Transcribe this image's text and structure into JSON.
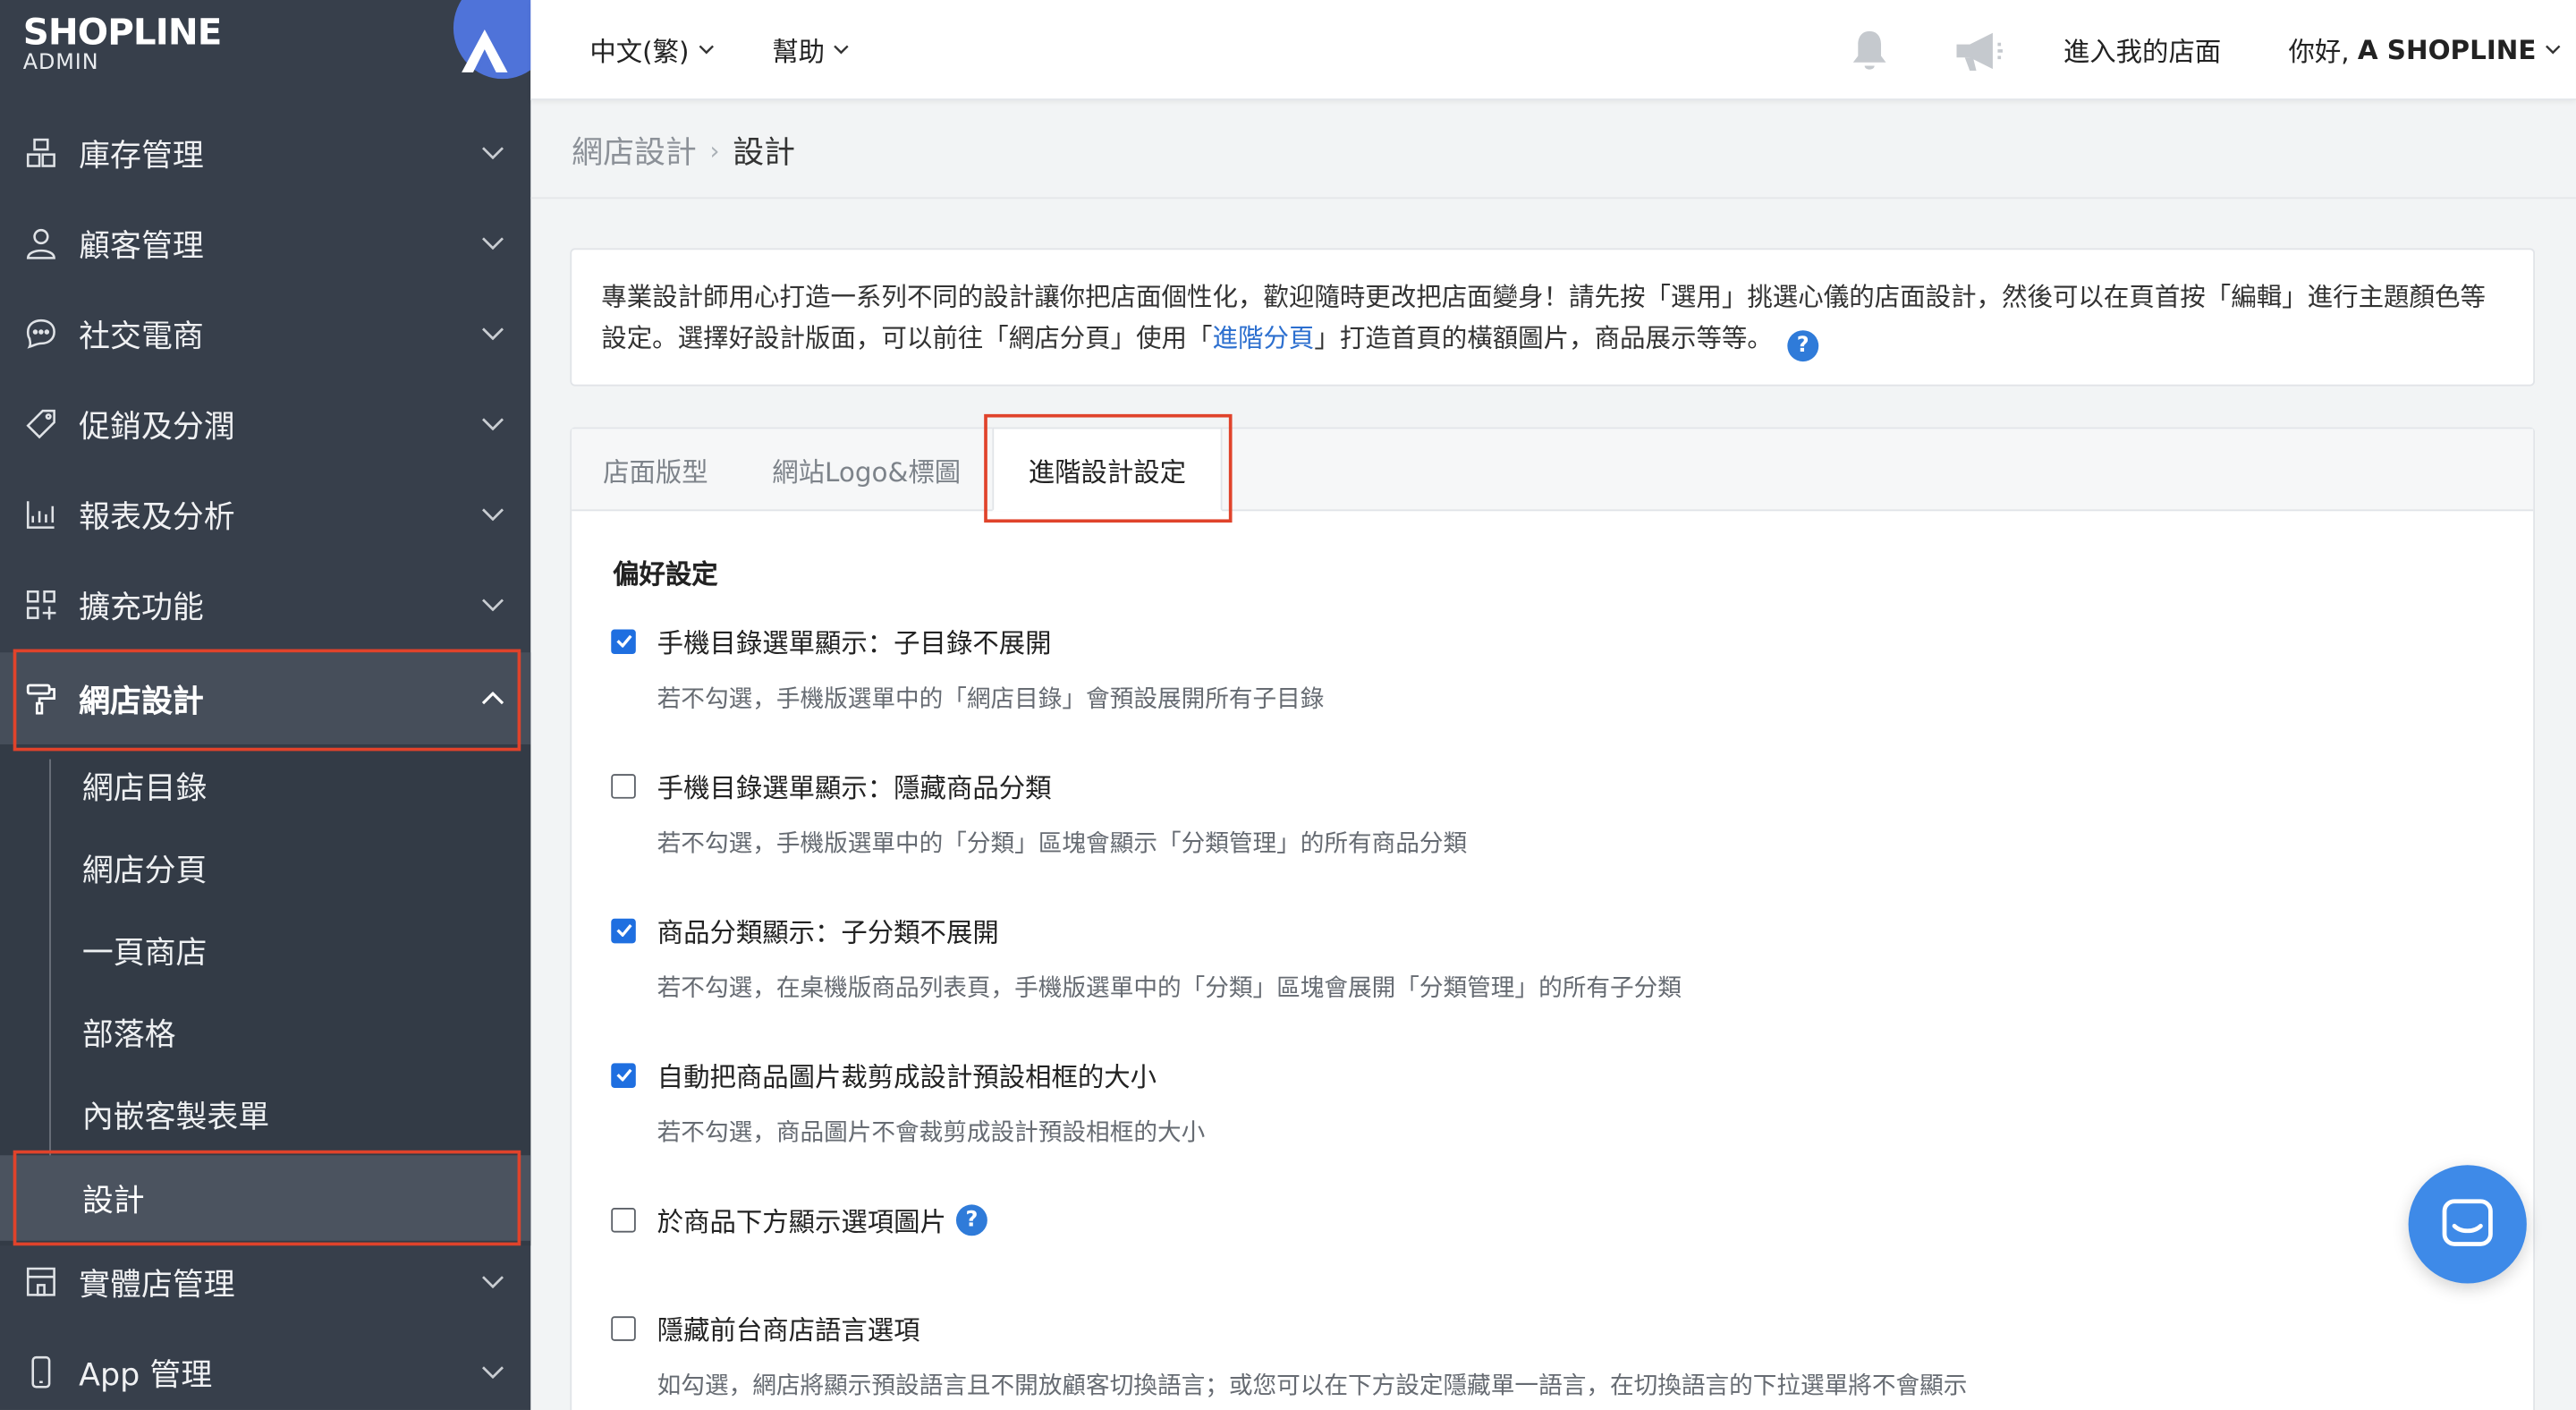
{
  "brand": {
    "logo_text": "SHOPLINE",
    "logo_sub": "ADMIN"
  },
  "sidebar": {
    "items": [
      {
        "label": "庫存管理",
        "icon": "inventory-icon"
      },
      {
        "label": "顧客管理",
        "icon": "user-icon"
      },
      {
        "label": "社交電商",
        "icon": "chat-bubble-icon"
      },
      {
        "label": "促銷及分潤",
        "icon": "tag-icon"
      },
      {
        "label": "報表及分析",
        "icon": "chart-icon"
      },
      {
        "label": "擴充功能",
        "icon": "apps-plus-icon"
      },
      {
        "label": "網店設計",
        "icon": "paint-roller-icon",
        "expanded": true
      },
      {
        "label": "實體店管理",
        "icon": "store-icon"
      },
      {
        "label": "App 管理",
        "icon": "mobile-icon"
      }
    ],
    "sub_items": [
      {
        "label": "網店目錄"
      },
      {
        "label": "網店分頁"
      },
      {
        "label": "一頁商店"
      },
      {
        "label": "部落格"
      },
      {
        "label": "內嵌客製表單"
      },
      {
        "label": "設計",
        "active": true
      }
    ]
  },
  "topbar": {
    "language": "中文(繁)",
    "help": "幫助",
    "visit_store": "進入我的店面",
    "greeting": "你好,",
    "user_name": "A SHOPLINE"
  },
  "breadcrumb": {
    "parent": "網店設計",
    "current": "設計"
  },
  "info": {
    "text_part1": "專業設計師用心打造一系列不同的設計讓你把店面個性化，歡迎隨時更改把店面變身！請先按「選用」挑選心儀的店面設計，然後可以在頁首按「編輯」進行主題顏色等設定。選擇好設計版面，可以前往「網店分頁」使用「",
    "link_text": "進階分頁",
    "text_part2": "」打造首頁的橫額圖片，商品展示等等。",
    "help_glyph": "?"
  },
  "tabs": [
    {
      "label": "店面版型"
    },
    {
      "label": "網站Logo&標圖"
    },
    {
      "label": "進階設計設定",
      "active": true
    }
  ],
  "preferences": {
    "title": "偏好設定",
    "options": [
      {
        "label": "手機目錄選單顯示：子目錄不展開",
        "checked": true,
        "hint": "若不勾選，手機版選單中的「網店目錄」會預設展開所有子目錄"
      },
      {
        "label": "手機目錄選單顯示：隱藏商品分類",
        "checked": false,
        "hint": "若不勾選，手機版選單中的「分類」區塊會顯示「分類管理」的所有商品分類"
      },
      {
        "label": "商品分類顯示：子分類不展開",
        "checked": true,
        "hint": "若不勾選，在桌機版商品列表頁，手機版選單中的「分類」區塊會展開「分類管理」的所有子分類"
      },
      {
        "label": "自動把商品圖片裁剪成設計預設相框的大小",
        "checked": true,
        "hint": "若不勾選，商品圖片不會裁剪成設計預設相框的大小"
      },
      {
        "label": "於商品下方顯示選項圖片",
        "checked": false,
        "hint": ""
      },
      {
        "label": "隱藏前台商店語言選項",
        "checked": false,
        "hint": "如勾選，網店將顯示預設語言且不開放顧客切換語言；或您可以在下方設定隱藏單一語言，在切換語言的下拉選單將不會顯示"
      }
    ]
  },
  "colors": {
    "sidebar_bg": "#373f4b",
    "accent": "#1f6fe0",
    "highlight": "#e0432b",
    "chat": "#3e8ae8"
  }
}
